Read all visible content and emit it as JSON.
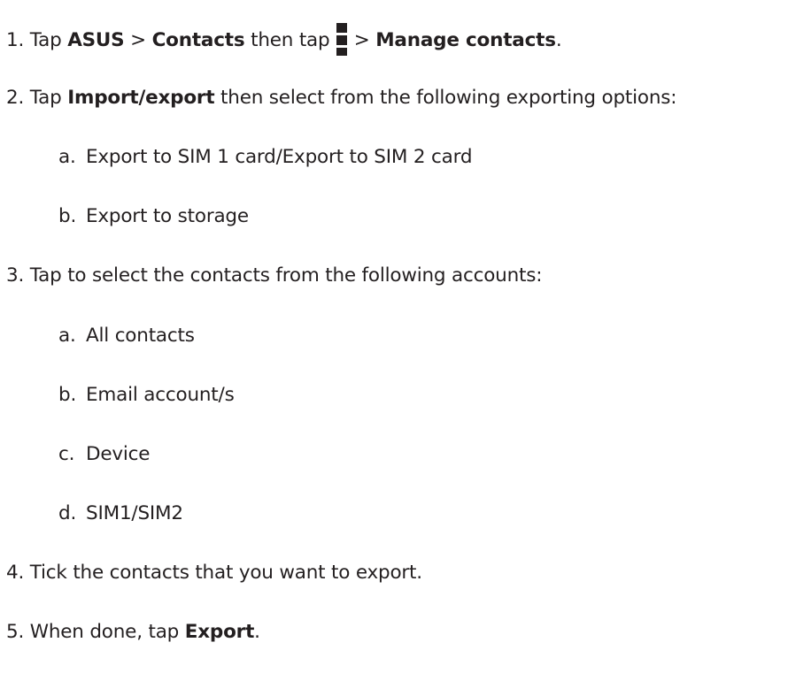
{
  "steps": [
    {
      "number": "1.",
      "parts": {
        "t1": "Tap ",
        "b1": "ASUS",
        "t2": " > ",
        "b2": "Contacts",
        "t3": "  then tap ",
        "icon": "menu-icon",
        "t4": " > ",
        "b3": "Manage contacts",
        "t5": "."
      }
    },
    {
      "number": "2.",
      "parts": {
        "t1": "Tap ",
        "b1": "Import/export",
        "t2": " then select from the following exporting options:"
      },
      "options": [
        {
          "letter": "a.",
          "text": "Export to SIM 1 card/Export to SIM 2 card"
        },
        {
          "letter": "b.",
          "text": "Export to storage"
        }
      ]
    },
    {
      "number": "3.",
      "parts": {
        "t1": " Tap to select the contacts from the following accounts:"
      },
      "options": [
        {
          "letter": "a.",
          "text": "All contacts"
        },
        {
          "letter": "b.",
          "text": "Email account/s"
        },
        {
          "letter": "c.",
          "text": "Device"
        },
        {
          "letter": "d.",
          "text": "SIM1/SIM2"
        }
      ]
    },
    {
      "number": "4.",
      "parts": {
        "t1": "Tick the contacts that you want to export."
      }
    },
    {
      "number": "5.",
      "parts": {
        "t1": "When done, tap ",
        "b1": "Export",
        "t2": "."
      }
    }
  ]
}
